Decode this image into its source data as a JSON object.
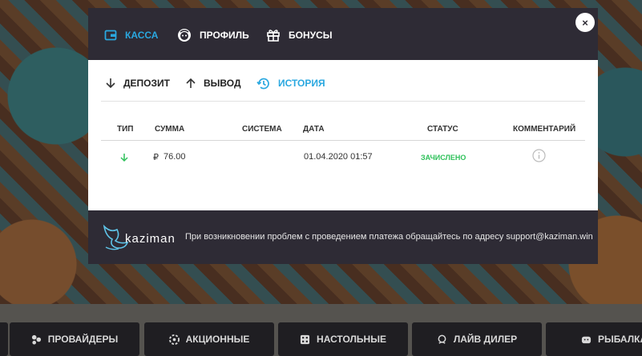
{
  "modal": {
    "close_label": "×",
    "tabs": [
      {
        "label": "КАССА",
        "icon": "wallet-icon",
        "active": true
      },
      {
        "label": "ПРОФИЛЬ",
        "icon": "face-icon",
        "active": false
      },
      {
        "label": "БОНУСЫ",
        "icon": "gift-icon",
        "active": false
      }
    ],
    "subtabs": [
      {
        "label": "ДЕПОЗИТ",
        "icon": "arrow-down-icon",
        "active": false
      },
      {
        "label": "ВЫВОД",
        "icon": "arrow-up-icon",
        "active": false
      },
      {
        "label": "ИСТОРИЯ",
        "icon": "history-icon",
        "active": true
      }
    ],
    "table": {
      "headers": [
        "ТИП",
        "СУММА",
        "СИСТЕМА",
        "ДАТА",
        "СТАТУС",
        "КОММЕНТАРИЙ"
      ],
      "rows": [
        {
          "type_icon": "arrow-down-green-icon",
          "currency": "₽",
          "amount": "76.00",
          "system": "",
          "date": "01.04.2020 01:57",
          "status": "ЗАЧИСЛЕНО",
          "comment_icon": "info-icon"
        }
      ]
    },
    "footer": {
      "logo_text": "kaziman",
      "message": "При возникновении проблем с проведением платежа обращайтесь по адресу support@kaziman.win"
    }
  },
  "bottom_nav": [
    {
      "label": "ПРОВАЙДЕРЫ",
      "icon": "providers-icon"
    },
    {
      "label": "АКЦИОННЫЕ",
      "icon": "promo-icon"
    },
    {
      "label": "НАСТОЛЬНЫЕ",
      "icon": "dice-icon"
    },
    {
      "label": "ЛАЙВ ДИЛЕР",
      "icon": "live-dealer-icon"
    },
    {
      "label": "РЫБАЛКА",
      "icon": "fishing-icon"
    }
  ],
  "colors": {
    "accent": "#2aa8e0",
    "modal_dark": "#2e2b35",
    "status_ok": "#2ec15a"
  }
}
